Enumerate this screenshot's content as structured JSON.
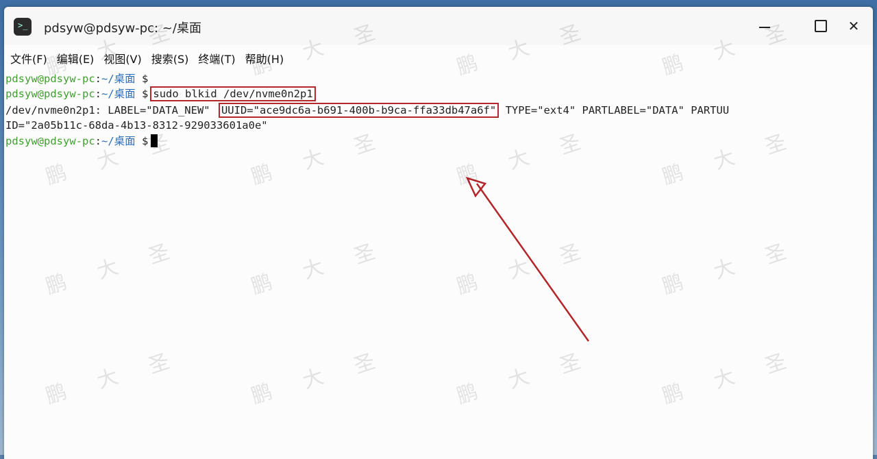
{
  "window": {
    "title": "pdsyw@pdsyw-pc: ~/桌面",
    "app_icon_glyph": ">_"
  },
  "menu": {
    "items": [
      {
        "label": "文件(F)"
      },
      {
        "label": "编辑(E)"
      },
      {
        "label": "视图(V)"
      },
      {
        "label": "搜索(S)"
      },
      {
        "label": "终端(T)"
      },
      {
        "label": "帮助(H)"
      }
    ]
  },
  "terminal": {
    "prompt_user": "pdsyw@pdsyw-pc",
    "prompt_sep": ":",
    "prompt_path": "~/桌面",
    "prompt_symbol": "$",
    "command": "sudo blkid /dev/nvme0n2p1",
    "output_line1_prefix": "/dev/nvme0n2p1: LABEL=\"DATA_NEW\" ",
    "output_line1_uuid": "UUID=\"ace9dc6a-b691-400b-b9ca-ffa33db47a6f\"",
    "output_line1_suffix": " TYPE=\"ext4\" PARTLABEL=\"DATA\" PARTUU",
    "output_line2": "ID=\"2a05b11c-68da-4b13-8312-929033601a0e\""
  },
  "watermark": {
    "chars": [
      "鹏",
      "大",
      "圣"
    ]
  },
  "colors": {
    "prompt_user": "#3fa12c",
    "prompt_path": "#2e6fb8",
    "highlight_box": "#b3262a",
    "arrow": "#b3262a"
  }
}
